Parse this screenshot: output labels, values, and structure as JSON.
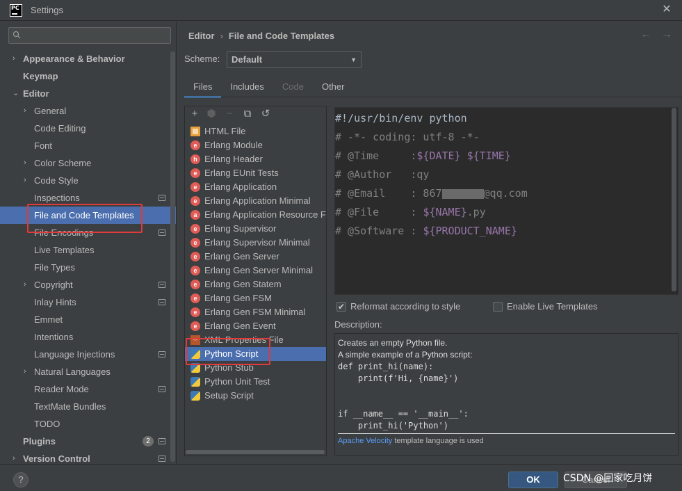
{
  "window": {
    "title": "Settings",
    "app_icon_text": "PC"
  },
  "sidebar": {
    "search": {
      "placeholder": ""
    },
    "items": [
      {
        "label": "Appearance & Behavior",
        "level": 0,
        "arrow": "›",
        "bold": true
      },
      {
        "label": "Keymap",
        "level": 0,
        "arrow": "",
        "bold": true
      },
      {
        "label": "Editor",
        "level": 0,
        "arrow": "⌄",
        "bold": true
      },
      {
        "label": "General",
        "level": 1,
        "arrow": "›"
      },
      {
        "label": "Code Editing",
        "level": 1,
        "arrow": ""
      },
      {
        "label": "Font",
        "level": 1,
        "arrow": ""
      },
      {
        "label": "Color Scheme",
        "level": 1,
        "arrow": "›"
      },
      {
        "label": "Code Style",
        "level": 1,
        "arrow": "›"
      },
      {
        "label": "Inspections",
        "level": 1,
        "arrow": "",
        "icon": true
      },
      {
        "label": "File and Code Templates",
        "level": 1,
        "arrow": "",
        "selected": true
      },
      {
        "label": "File Encodings",
        "level": 1,
        "arrow": "",
        "icon": true
      },
      {
        "label": "Live Templates",
        "level": 1,
        "arrow": ""
      },
      {
        "label": "File Types",
        "level": 1,
        "arrow": ""
      },
      {
        "label": "Copyright",
        "level": 1,
        "arrow": "›",
        "icon": true
      },
      {
        "label": "Inlay Hints",
        "level": 1,
        "arrow": "",
        "icon": true
      },
      {
        "label": "Emmet",
        "level": 1,
        "arrow": ""
      },
      {
        "label": "Intentions",
        "level": 1,
        "arrow": ""
      },
      {
        "label": "Language Injections",
        "level": 1,
        "arrow": "",
        "icon": true
      },
      {
        "label": "Natural Languages",
        "level": 1,
        "arrow": "›"
      },
      {
        "label": "Reader Mode",
        "level": 1,
        "arrow": "",
        "icon": true
      },
      {
        "label": "TextMate Bundles",
        "level": 1,
        "arrow": ""
      },
      {
        "label": "TODO",
        "level": 1,
        "arrow": ""
      },
      {
        "label": "Plugins",
        "level": 0,
        "arrow": "",
        "bold": true,
        "count": "2",
        "icon": true
      },
      {
        "label": "Version Control",
        "level": 0,
        "arrow": "›",
        "bold": true,
        "icon": true
      }
    ]
  },
  "main": {
    "breadcrumb": [
      "Editor",
      "File and Code Templates"
    ],
    "breadcrumb_sep": "›",
    "nav": {
      "back": "←",
      "forward": "→"
    },
    "scheme": {
      "label": "Scheme:",
      "value": "Default"
    },
    "tabs": [
      {
        "label": "Files",
        "active": true
      },
      {
        "label": "Includes"
      },
      {
        "label": "Code",
        "disabled": true
      },
      {
        "label": "Other"
      }
    ],
    "toolbar": {
      "add": "+",
      "copy_settings": "⬢",
      "remove": "−",
      "copy": "⧉",
      "reset": "↺"
    },
    "templates": [
      {
        "label": "HTML File",
        "icon": "html"
      },
      {
        "label": "Erlang Module",
        "icon": "erlang",
        "glyph": "e"
      },
      {
        "label": "Erlang Header",
        "icon": "erlang",
        "glyph": "h"
      },
      {
        "label": "Erlang EUnit Tests",
        "icon": "erlang",
        "glyph": "e"
      },
      {
        "label": "Erlang Application",
        "icon": "erlang",
        "glyph": "e"
      },
      {
        "label": "Erlang Application Minimal",
        "icon": "erlang",
        "glyph": "e"
      },
      {
        "label": "Erlang Application Resource Fi",
        "icon": "erlang",
        "glyph": "a"
      },
      {
        "label": "Erlang Supervisor",
        "icon": "erlang",
        "glyph": "e"
      },
      {
        "label": "Erlang Supervisor Minimal",
        "icon": "erlang",
        "glyph": "e"
      },
      {
        "label": "Erlang Gen Server",
        "icon": "erlang",
        "glyph": "e"
      },
      {
        "label": "Erlang Gen Server Minimal",
        "icon": "erlang",
        "glyph": "e"
      },
      {
        "label": "Erlang Gen Statem",
        "icon": "erlang",
        "glyph": "e"
      },
      {
        "label": "Erlang Gen FSM",
        "icon": "erlang",
        "glyph": "e"
      },
      {
        "label": "Erlang Gen FSM Minimal",
        "icon": "erlang",
        "glyph": "e"
      },
      {
        "label": "Erlang Gen Event",
        "icon": "erlang",
        "glyph": "e"
      },
      {
        "label": "XML Properties File",
        "icon": "xml",
        "glyph": "<>"
      },
      {
        "label": "Python Script",
        "icon": "py",
        "selected": true
      },
      {
        "label": "Python Stub",
        "icon": "py"
      },
      {
        "label": "Python Unit Test",
        "icon": "py"
      },
      {
        "label": "Setup Script",
        "icon": "py"
      }
    ],
    "editor": {
      "lines": [
        [
          {
            "t": "#!/usr/bin/env python",
            "c": "plain"
          }
        ],
        [
          {
            "t": "# -*- coding: utf-8 -*-",
            "c": "comment"
          }
        ],
        [
          {
            "t": "# @Time     :",
            "c": "comment"
          },
          {
            "t": "${DATE} ${TIME}",
            "c": "var"
          }
        ],
        [
          {
            "t": "# @Author   :qy",
            "c": "comment"
          }
        ],
        [
          {
            "t": "# @Email    : 867",
            "c": "comment"
          },
          {
            "t": "",
            "c": "masked"
          },
          {
            "t": "@qq.com",
            "c": "comment"
          }
        ],
        [
          {
            "t": "# @File     : ",
            "c": "comment"
          },
          {
            "t": "${NAME}",
            "c": "var"
          },
          {
            "t": ".py",
            "c": "comment"
          }
        ],
        [
          {
            "t": "# @Software : ",
            "c": "comment"
          },
          {
            "t": "${PRODUCT_NAME}",
            "c": "var"
          }
        ]
      ]
    },
    "options": {
      "reformat": {
        "label": "Reformat according to style",
        "checked": true
      },
      "live_templates": {
        "label": "Enable Live Templates",
        "checked": false
      }
    },
    "description": {
      "label": "Description:",
      "line1": "Creates an empty Python file.",
      "line2": "A simple example of a Python script:",
      "code": "def print_hi(name):\n    print(f'Hi, {name}')\n\n\nif __name__ == '__main__':\n    print_hi('Python')",
      "footer_link": "Apache Velocity",
      "footer_text": " template language is used"
    }
  },
  "footer": {
    "help": "?",
    "ok_label": "OK",
    "cancel_label": "Cancel",
    "watermark": "CSDN @回家吃月饼"
  },
  "colors": {
    "selection": "#4b6eaf",
    "annotation": "#e03a3a",
    "accent_tab": "#4a88c7",
    "template_var": "#9876aa"
  }
}
